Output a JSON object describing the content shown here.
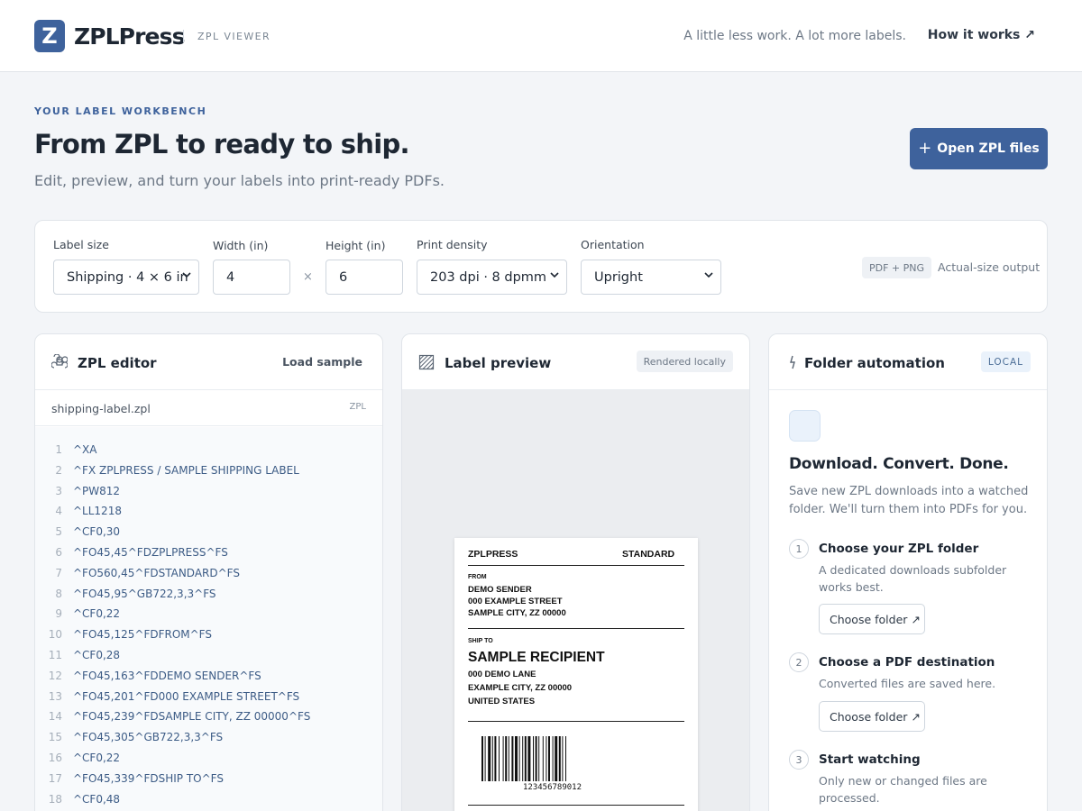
{
  "header": {
    "logo_letter": "Z",
    "brand": "ZPLPress",
    "subtitle": "ZPL VIEWER",
    "tagline": "A little less work. A lot more labels.",
    "how_link": "How it works ↗"
  },
  "hero": {
    "eyebrow": "YOUR LABEL WORKBENCH",
    "title": "From ZPL to ready to ship.",
    "subtitle": "Edit, preview, and turn your labels into print-ready PDFs.",
    "open_button": "Open ZPL files",
    "open_button_icon": "+"
  },
  "settings": {
    "label_size": {
      "label": "Label size",
      "value": "Shipping · 4 × 6 in"
    },
    "width": {
      "label": "Width (in)",
      "value": "4"
    },
    "times": "×",
    "height": {
      "label": "Height (in)",
      "value": "6"
    },
    "density": {
      "label": "Print density",
      "value": "203 dpi · 8 dpmm"
    },
    "orientation": {
      "label": "Orientation",
      "value": "Upright"
    },
    "format_pill": "PDF + PNG",
    "output_note": "Actual-size output"
  },
  "editor": {
    "title": "ZPL editor",
    "load_sample": "Load sample",
    "file_name": "shipping-label.zpl",
    "file_type": "ZPL",
    "lines": [
      {
        "n": "1",
        "code": "^XA"
      },
      {
        "n": "2",
        "code": "^FX ZPLPRESS / SAMPLE SHIPPING LABEL"
      },
      {
        "n": "3",
        "code": "^PW812"
      },
      {
        "n": "4",
        "code": "^LL1218"
      },
      {
        "n": "5",
        "code": "^CF0,30"
      },
      {
        "n": "6",
        "code": "^FO45,45^FDZPLPRESS^FS"
      },
      {
        "n": "7",
        "code": "^FO560,45^FDSTANDARD^FS"
      },
      {
        "n": "8",
        "code": "^FO45,95^GB722,3,3^FS"
      },
      {
        "n": "9",
        "code": "^CF0,22"
      },
      {
        "n": "10",
        "code": "^FO45,125^FDFROM^FS"
      },
      {
        "n": "11",
        "code": "^CF0,28"
      },
      {
        "n": "12",
        "code": "^FO45,163^FDDEMO SENDER^FS"
      },
      {
        "n": "13",
        "code": "^FO45,201^FD000 EXAMPLE STREET^FS"
      },
      {
        "n": "14",
        "code": "^FO45,239^FDSAMPLE CITY, ZZ 00000^FS"
      },
      {
        "n": "15",
        "code": "^FO45,305^GB722,3,3^FS"
      },
      {
        "n": "16",
        "code": "^CF0,22"
      },
      {
        "n": "17",
        "code": "^FO45,339^FDSHIP TO^FS"
      },
      {
        "n": "18",
        "code": "^CF0,48"
      }
    ]
  },
  "preview": {
    "title": "Label preview",
    "status": "Rendered locally",
    "label": {
      "brand": "ZPLPRESS",
      "service": "STANDARD",
      "from_heading": "FROM",
      "from_line1": "DEMO SENDER",
      "from_line2": "000 EXAMPLE STREET",
      "from_line3": "SAMPLE CITY, ZZ 00000",
      "to_heading": "SHIP TO",
      "to_name": "SAMPLE RECIPIENT",
      "to_line1": "000 DEMO LANE",
      "to_line2": "EXAMPLE CITY, ZZ 00000",
      "to_line3": "UNITED STATES",
      "barcode_text": "123456789012"
    }
  },
  "automation": {
    "title": "Folder automation",
    "badge": "LOCAL",
    "headline": "Download. Convert. Done.",
    "description": "Save new ZPL downloads into a watched folder. We'll turn them into PDFs for you.",
    "steps": [
      {
        "num": "1",
        "title": "Choose your ZPL folder",
        "desc": "A dedicated downloads subfolder works best.",
        "button": "Choose folder ↗"
      },
      {
        "num": "2",
        "title": "Choose a PDF destination",
        "desc": "Converted files are saved here.",
        "button": "Choose folder ↗"
      },
      {
        "num": "3",
        "title": "Start watching",
        "desc": "Only new or changed files are processed."
      }
    ]
  }
}
